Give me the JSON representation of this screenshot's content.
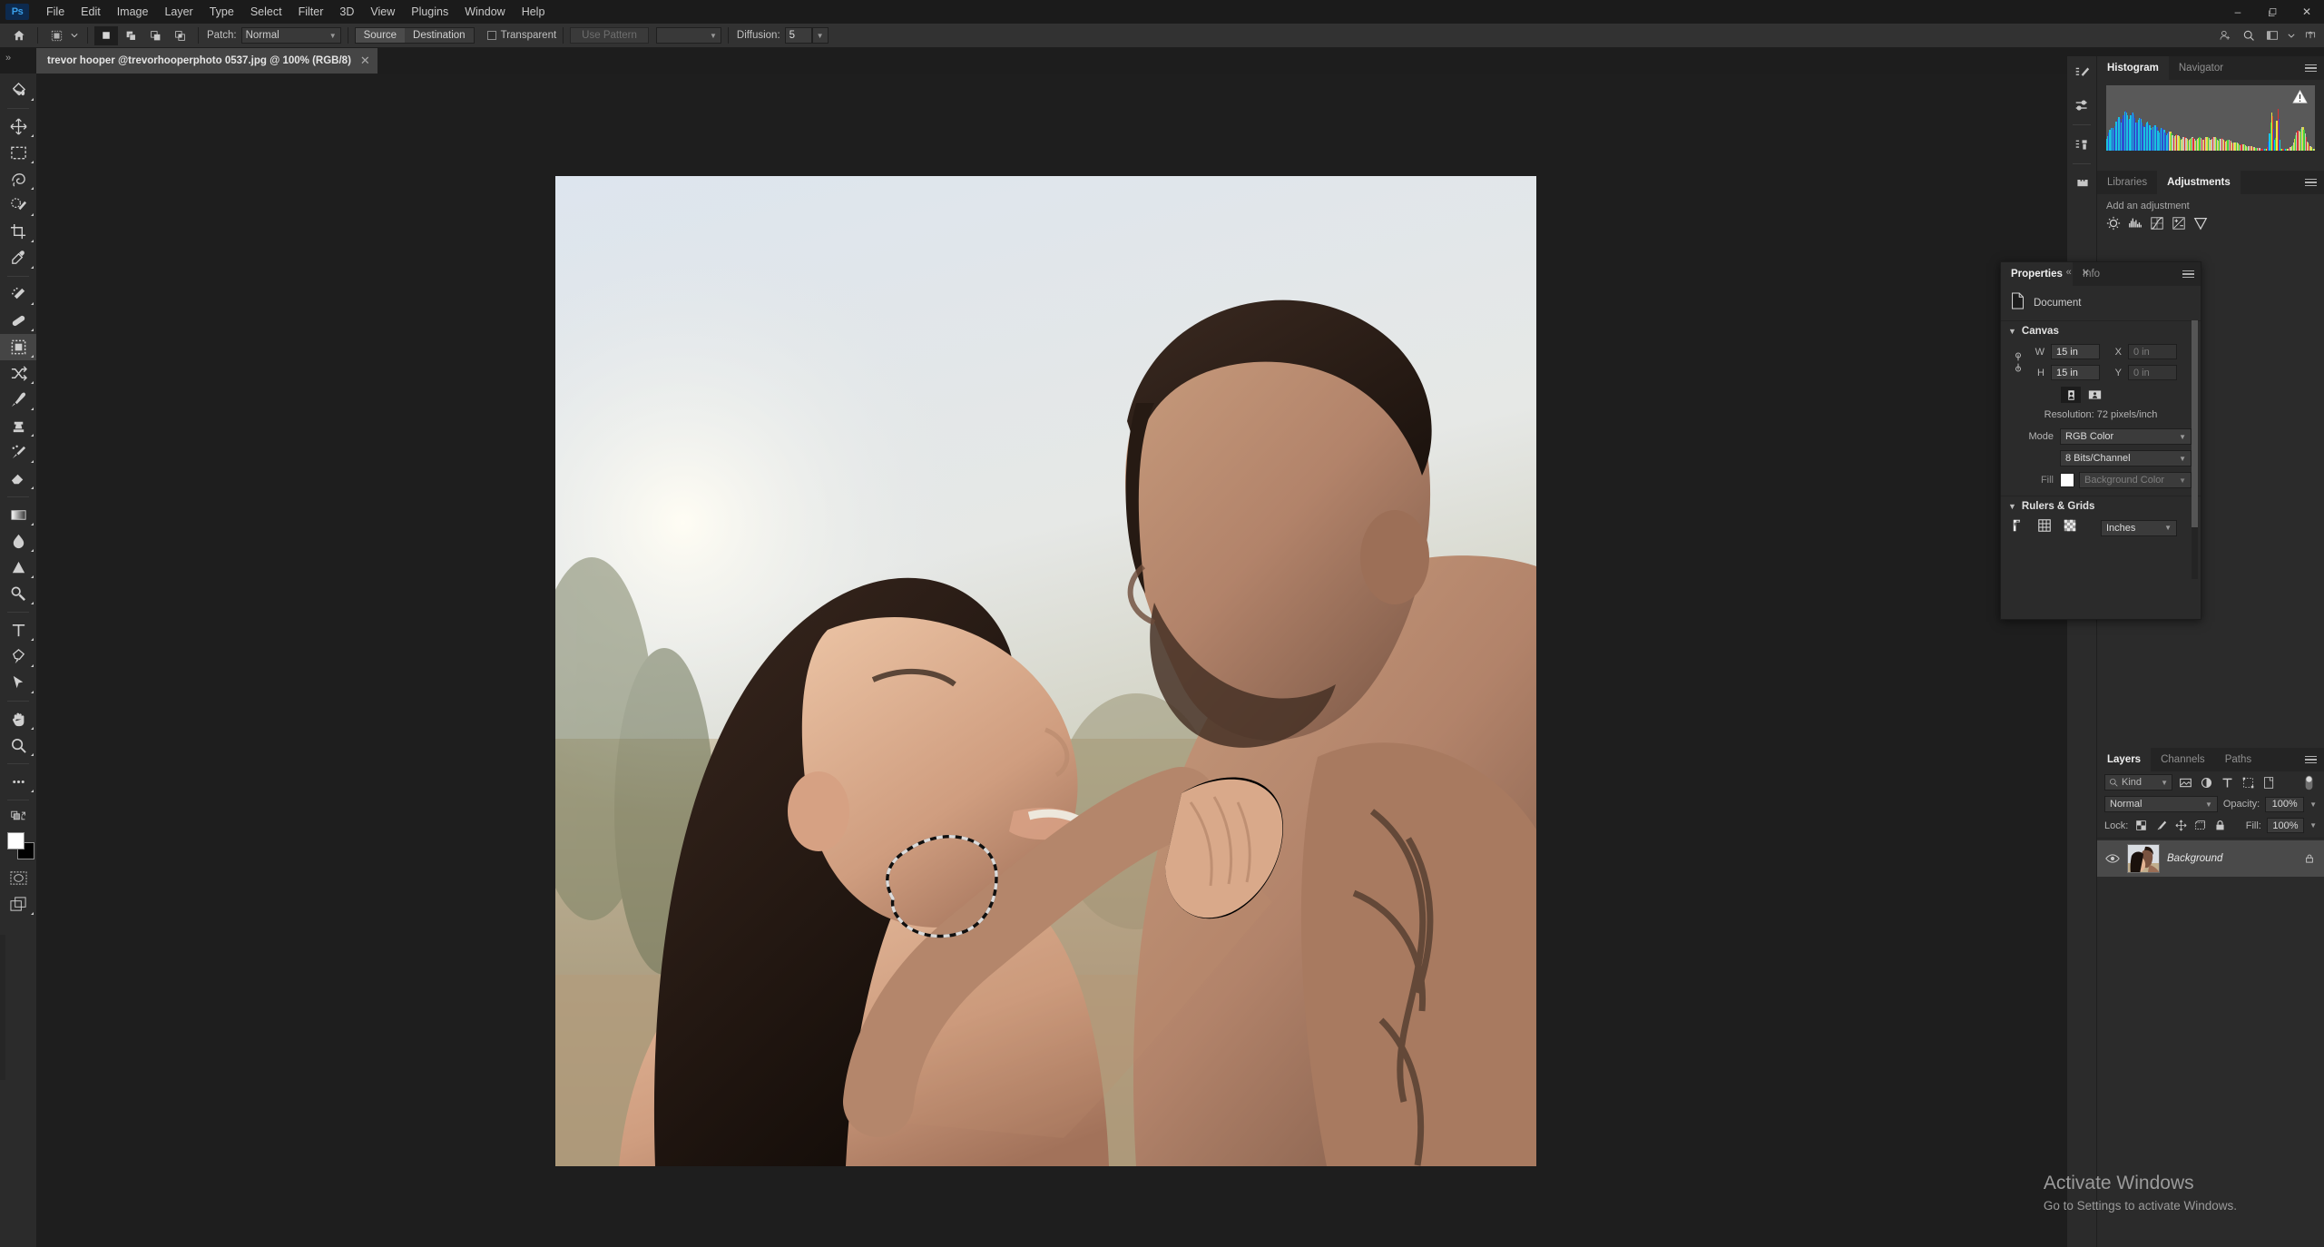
{
  "app": {
    "name": "Ps",
    "logo_label": "Ps"
  },
  "menubar": {
    "items": [
      "File",
      "Edit",
      "Image",
      "Layer",
      "Type",
      "Select",
      "Filter",
      "3D",
      "View",
      "Plugins",
      "Window",
      "Help"
    ]
  },
  "window_controls": {
    "minimize": "–",
    "maximize": "❐",
    "close": "✕"
  },
  "options_bar": {
    "home_icon": "home-icon",
    "tool_preset_icon": "patch-tool-icon",
    "mode_icons": [
      "new-selection-icon",
      "add-to-selection-icon",
      "subtract-from-selection-icon",
      "intersect-selection-icon"
    ],
    "patch_label": "Patch:",
    "patch_value": "Normal",
    "source_label": "Source",
    "destination_label": "Destination",
    "transparent_label": "Transparent",
    "use_pattern_label": "Use Pattern",
    "pattern_swatch": "pattern-picker",
    "diffusion_label": "Diffusion:",
    "diffusion_value": "5",
    "right_icons": [
      "share-icon",
      "search-icon",
      "workspace-icon",
      "chevron-down-icon",
      "cloud-upload-icon"
    ]
  },
  "document_tab": {
    "title": "trevor hooper @trevorhooperphoto 0537.jpg @ 100% (RGB/8)",
    "close": "✕",
    "collapse": "»"
  },
  "toolbar": {
    "tools": [
      {
        "name": "move-tool",
        "icon": "paint-bucket-move",
        "glyph": "bucket"
      },
      {
        "name": "artboard-move-tool",
        "glyph": "move"
      },
      {
        "name": "rectangular-marquee-tool",
        "glyph": "marquee"
      },
      {
        "name": "lasso-tool",
        "glyph": "lasso"
      },
      {
        "name": "object-selection-tool",
        "glyph": "quickselect"
      },
      {
        "name": "crop-tool",
        "glyph": "crop"
      },
      {
        "name": "eyedropper-tool",
        "glyph": "eyedropper"
      },
      {
        "name": "spot-healing-brush-tool",
        "glyph": "spot"
      },
      {
        "name": "healing-brush-tool",
        "glyph": "heal"
      },
      {
        "name": "patch-tool",
        "glyph": "patch",
        "active": true
      },
      {
        "name": "shuffle-tool",
        "glyph": "shuffle"
      },
      {
        "name": "brush-tool",
        "glyph": "brush"
      },
      {
        "name": "clone-stamp-tool",
        "glyph": "stamp"
      },
      {
        "name": "history-brush-tool",
        "glyph": "historybrush"
      },
      {
        "name": "eraser-tool",
        "glyph": "eraser"
      },
      {
        "name": "gradient-tool",
        "glyph": "gradient"
      },
      {
        "name": "blur-tool",
        "glyph": "blur"
      },
      {
        "name": "dodge-tool",
        "glyph": "dodgeburn"
      },
      {
        "name": "burn-tool",
        "glyph": "dodge"
      },
      {
        "name": "type-tool",
        "glyph": "type"
      },
      {
        "name": "pen-tool",
        "glyph": "pen"
      },
      {
        "name": "path-selection-tool",
        "glyph": "pathselect"
      },
      {
        "name": "hand-tool",
        "glyph": "hand"
      },
      {
        "name": "zoom-tool",
        "glyph": "zoom"
      },
      {
        "name": "edit-toolbar",
        "glyph": "dots"
      }
    ],
    "swap_colors_icon": "swap-colors-icon",
    "default_colors_icon": "default-colors-icon",
    "foreground_color": "#ffffff",
    "background_color": "#000000",
    "quick_mask_icon": "quick-mask-icon",
    "screen_mode_icon": "screen-mode-icon"
  },
  "histogram_panel": {
    "tabs": [
      "Histogram",
      "Navigator"
    ],
    "selected_tab": "Histogram",
    "warning_icon": "cached-data-warning-icon"
  },
  "adjustments_panel": {
    "tabs": [
      "Libraries",
      "Adjustments"
    ],
    "selected_tab": "Adjustments",
    "hint": "Add an adjustment",
    "icons": [
      "brightness-contrast-icon",
      "levels-icon",
      "curves-icon",
      "exposure-icon",
      "vibrance-icon"
    ]
  },
  "properties_panel": {
    "tabs": [
      "Properties",
      "Info"
    ],
    "selected_tab": "Properties",
    "doc_icon": "document-icon",
    "doc_label": "Document",
    "mini_icons": [
      "collapse-icon",
      "close-icon"
    ],
    "sections": {
      "canvas": {
        "title": "Canvas",
        "link_icon": "link-constrain-icon",
        "w_label": "W",
        "w_value": "15 in",
        "h_label": "H",
        "h_value": "15 in",
        "x_label": "X",
        "x_value": "0 in",
        "y_label": "Y",
        "y_value": "0 in",
        "orientation_portrait_icon": "portrait-orientation-icon",
        "orientation_landscape_icon": "landscape-orientation-icon",
        "resolution": "Resolution: 72 pixels/inch",
        "mode_label": "Mode",
        "mode_value": "RGB Color",
        "depth_value": "8 Bits/Channel",
        "fill_label": "Fill",
        "fill_swatch": "#ffffff",
        "fill_value": "Background Color"
      },
      "rulers_grids": {
        "title": "Rulers & Grids",
        "rulers_icon": "rulers-icon",
        "grid-icon": "grid-icon",
        "transparency_icon": "transparency-grid-icon",
        "units_value": "Inches"
      }
    }
  },
  "layers_panel": {
    "tabs": [
      "Layers",
      "Channels",
      "Paths"
    ],
    "selected_tab": "Layers",
    "filter_label": "Kind",
    "filter_icons": [
      "pixel-filter-icon",
      "adjustment-filter-icon",
      "type-filter-icon",
      "shape-filter-icon",
      "smartobject-filter-icon"
    ],
    "filter_toggle_icon": "filter-toggle-icon",
    "blend_mode": "Normal",
    "opacity_label": "Opacity:",
    "opacity_value": "100%",
    "lock_label": "Lock:",
    "lock_icons": [
      "lock-transparency-icon",
      "lock-image-icon",
      "lock-position-icon",
      "lock-artboard-icon",
      "lock-all-icon"
    ],
    "fill_label": "Fill:",
    "fill_value": "100%",
    "layers": [
      {
        "name": "Background",
        "visible": true,
        "locked": true,
        "lock_icon": "lock-icon",
        "eye_icon": "eye-icon"
      }
    ]
  },
  "watermark": {
    "title": "Activate Windows",
    "subtitle": "Go to Settings to activate Windows."
  },
  "canvas": {
    "zoom": "100%",
    "selection": "patch-selection-path"
  }
}
